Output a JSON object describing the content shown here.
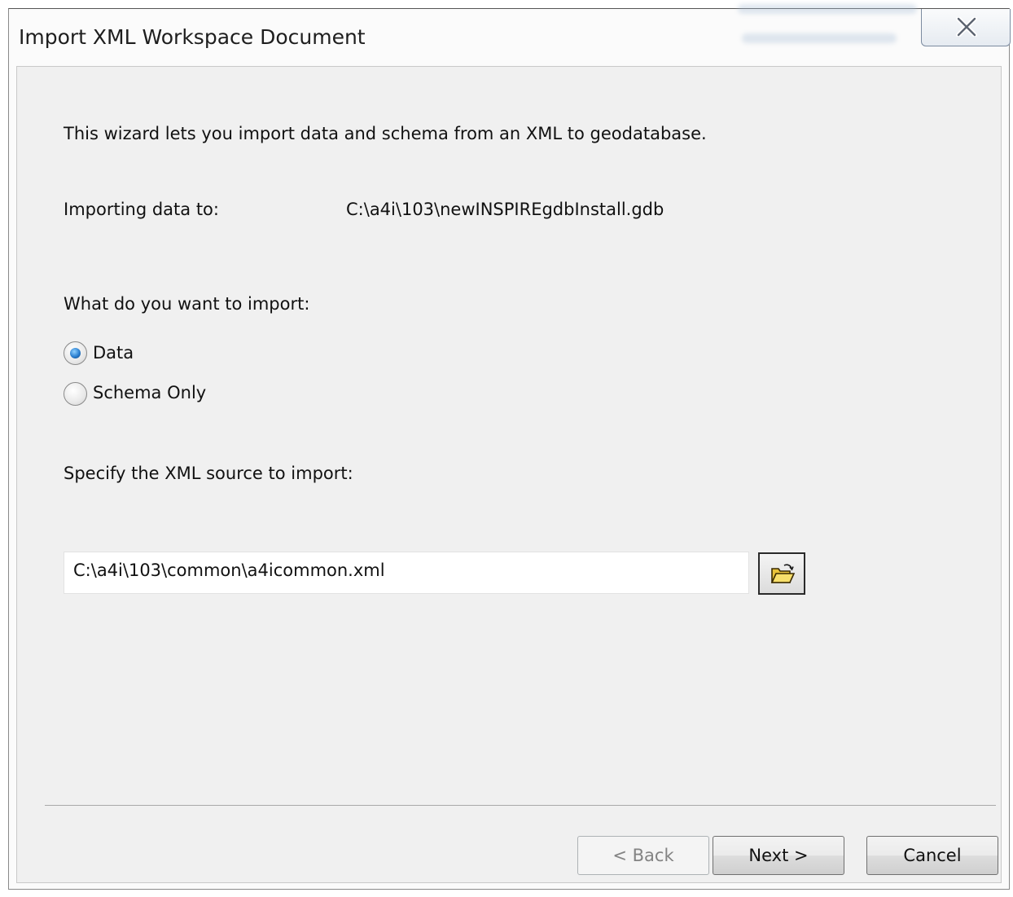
{
  "window": {
    "title": "Import XML Workspace Document"
  },
  "intro": {
    "text": "This wizard lets you import data and schema from an XML to geodatabase."
  },
  "target": {
    "label": "Importing data to:",
    "value": "C:\\a4i\\103\\newINSPIREgdbInstall.gdb"
  },
  "import_options": {
    "question": "What do you want to import:",
    "options": [
      {
        "label": "Data",
        "checked": true
      },
      {
        "label": "Schema Only",
        "checked": false
      }
    ]
  },
  "source": {
    "label": "Specify the XML source to import:",
    "value": "C:\\a4i\\103\\common\\a4icommon.xml"
  },
  "buttons": {
    "back": "< Back",
    "next": "Next >",
    "cancel": "Cancel"
  },
  "icons": {
    "close": "close-x-icon",
    "browse": "open-folder-icon"
  }
}
